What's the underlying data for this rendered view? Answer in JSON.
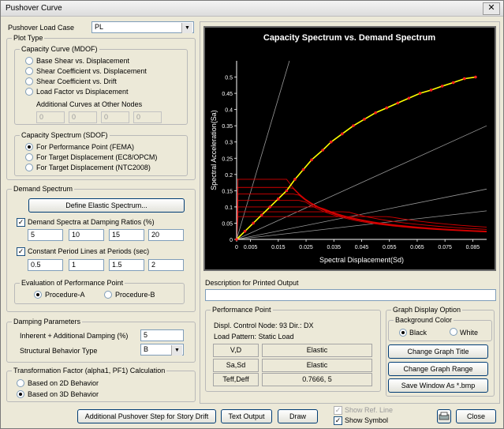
{
  "window": {
    "title": "Pushover Curve",
    "close_glyph": "✕"
  },
  "load_case": {
    "label": "Pushover Load Case",
    "value": "PL"
  },
  "plot_type": {
    "label": "Plot Type",
    "capacity_curve": {
      "label": "Capacity Curve (MDOF)",
      "options": [
        "Base Shear vs. Displacement",
        "Shear Coefficient vs. Displacement",
        "Shear Coefficient vs. Drift",
        "Load Factor vs Displacement"
      ],
      "additional_label": "Additional Curves at Other Nodes",
      "nodes": [
        "0",
        "0",
        "0",
        "0"
      ]
    },
    "capacity_spectrum": {
      "label": "Capacity Spectrum (SDOF)",
      "options": [
        "For Performance Point (FEMA)",
        "For Target Displacement (EC8/OPCM)",
        "For Target Displacement (NTC2008)"
      ],
      "selected": 0
    }
  },
  "demand": {
    "label": "Demand Spectrum",
    "define_button": "Define Elastic Spectrum...",
    "damping_check": "Demand Spectra at Damping Ratios (%)",
    "damping_values": [
      "5",
      "10",
      "15",
      "20"
    ],
    "period_check": "Constant Period Lines at Periods (sec)",
    "period_values": [
      "0.5",
      "1",
      "1.5",
      "2"
    ],
    "evaluation": {
      "label": "Evaluation of Performance Point",
      "options": [
        "Procedure-A",
        "Procedure-B"
      ],
      "selected": 0
    }
  },
  "damping_params": {
    "label": "Damping Parameters",
    "inherent_label": "Inherent + Additional Damping (%)",
    "inherent_value": "5",
    "behavior_label": "Structural Behavior Type",
    "behavior_value": "B"
  },
  "transformation": {
    "label": "Transformation Factor (alpha1, PF1) Calculation",
    "options": [
      "Based on 2D Behavior",
      "Based on 3D Behavior"
    ],
    "selected": 1
  },
  "description": {
    "label": "Description for Printed Output",
    "value": ""
  },
  "performance": {
    "label": "Performance Point",
    "control_node": "Displ. Control Node: 93  Dir.: DX",
    "load_pattern": "Load Pattern: Static Load",
    "rows": [
      {
        "key": "V,D",
        "value": "Elastic"
      },
      {
        "key": "Sa,Sd",
        "value": "Elastic"
      },
      {
        "key": "Teff,Deff",
        "value": "0.7666,      5"
      }
    ]
  },
  "graph_option": {
    "label": "Graph Display Option",
    "bg_label": "Background Color",
    "bg_options": [
      "Black",
      "White"
    ],
    "bg_selected": 0,
    "buttons": [
      "Change Graph Title",
      "Change Graph Range",
      "Save Window As *.bmp"
    ]
  },
  "bottom": {
    "additional_button": "Additional Pushover Step for Story Drift",
    "text_output": "Text Output",
    "draw": "Draw",
    "show_ref_line": "Show Ref. Line",
    "show_symbol": "Show Symbol",
    "close": "Close"
  },
  "chart_data": {
    "type": "line",
    "title": "Capacity Spectrum vs. Demand Spectrum",
    "xlabel": "Spectral Displacement(Sd)",
    "ylabel": "Spectral Acceleration(Sa)",
    "xlim": [
      0,
      0.09
    ],
    "ylim": [
      0,
      0.55
    ],
    "xticks": [
      "0",
      "0.005",
      "0.015",
      "0.025",
      "0.035",
      "0.045",
      "0.055",
      "0.065",
      "0.075",
      "0.085"
    ],
    "yticks": [
      "0",
      "0.05",
      "0.1",
      "0.15",
      "0.2",
      "0.25",
      "0.3",
      "0.35",
      "0.4",
      "0.45",
      "0.5"
    ],
    "background": "#000000",
    "series": [
      {
        "color": "#ffff00",
        "marker_color": "#ff2020",
        "x": [
          0,
          0.003,
          0.006,
          0.009,
          0.012,
          0.015,
          0.018,
          0.021,
          0.024,
          0.027,
          0.031,
          0.034,
          0.038,
          0.042,
          0.046,
          0.05,
          0.054,
          0.058,
          0.062,
          0.066,
          0.07,
          0.074,
          0.078,
          0.082,
          0.086
        ],
        "y": [
          0,
          0.025,
          0.05,
          0.075,
          0.1,
          0.125,
          0.15,
          0.185,
          0.215,
          0.245,
          0.275,
          0.3,
          0.325,
          0.35,
          0.37,
          0.39,
          0.405,
          0.42,
          0.435,
          0.45,
          0.46,
          0.472,
          0.483,
          0.495,
          0.5
        ]
      }
    ],
    "period_lines": [
      {
        "color": "#9a9a9a",
        "end": [
          0.019,
          0.55
        ]
      },
      {
        "color": "#9a9a9a",
        "end": [
          0.09,
          0.35
        ]
      },
      {
        "color": "#9a9a9a",
        "end": [
          0.09,
          0.155
        ]
      },
      {
        "color": "#9a9a9a",
        "end": [
          0.09,
          0.088
        ]
      }
    ],
    "demand_color": "#d40000"
  }
}
